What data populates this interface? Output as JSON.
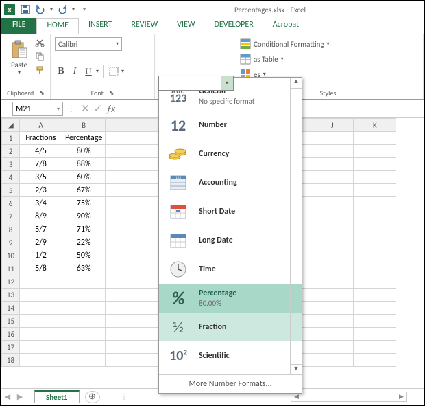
{
  "app": {
    "title": "Percentages.xlsx - Excel"
  },
  "qat": {
    "save": "save",
    "undo": "undo",
    "redo": "redo"
  },
  "tabs": {
    "file": "FILE",
    "home": "HOME",
    "insert": "INSERT",
    "review": "REVIEW",
    "view": "VIEW",
    "developer": "DEVELOPER",
    "acrobat": "Acrobat"
  },
  "ribbon": {
    "clipboard": {
      "paste": "Paste",
      "label": "Clipboard"
    },
    "font": {
      "family": "Calibri",
      "bold": "B",
      "italic": "I",
      "underline": "U",
      "label": "Font"
    },
    "styles": {
      "cond": "Conditional Formatting",
      "table": "as Table",
      "cell": "es",
      "label": "Styles"
    }
  },
  "fbar": {
    "namebox": "M21"
  },
  "grid": {
    "cols": [
      "A",
      "B",
      "J",
      "K"
    ],
    "rows": [
      {
        "n": "1",
        "a": "Fractions",
        "b": "Percentage"
      },
      {
        "n": "2",
        "a": "4/5",
        "b": "80%"
      },
      {
        "n": "3",
        "a": "7/8",
        "b": "88%"
      },
      {
        "n": "4",
        "a": "3/5",
        "b": "60%"
      },
      {
        "n": "5",
        "a": "2/3",
        "b": "67%"
      },
      {
        "n": "6",
        "a": "3/4",
        "b": "75%"
      },
      {
        "n": "7",
        "a": "8/9",
        "b": "90%"
      },
      {
        "n": "8",
        "a": "5/7",
        "b": "71%"
      },
      {
        "n": "9",
        "a": "2/9",
        "b": "22%"
      },
      {
        "n": "10",
        "a": "1/2",
        "b": "50%"
      },
      {
        "n": "11",
        "a": "5/8",
        "b": "63%"
      },
      {
        "n": "12",
        "a": "",
        "b": ""
      },
      {
        "n": "13",
        "a": "",
        "b": ""
      },
      {
        "n": "14",
        "a": "",
        "b": ""
      },
      {
        "n": "15",
        "a": "",
        "b": ""
      },
      {
        "n": "16",
        "a": "",
        "b": ""
      },
      {
        "n": "17",
        "a": "",
        "b": ""
      },
      {
        "n": "18",
        "a": "",
        "b": ""
      }
    ]
  },
  "nf": {
    "general": {
      "name": "General",
      "sub": "No specific format"
    },
    "number": {
      "name": "Number"
    },
    "currency": {
      "name": "Currency"
    },
    "accounting": {
      "name": "Accounting"
    },
    "shortdate": {
      "name": "Short Date"
    },
    "longdate": {
      "name": "Long Date"
    },
    "time": {
      "name": "Time"
    },
    "percentage": {
      "name": "Percentage",
      "sub": "80.00%"
    },
    "fraction": {
      "name": "Fraction"
    },
    "scientific": {
      "name": "Scientific"
    },
    "more": "More Number Formats..."
  },
  "sheet": {
    "name": "Sheet1"
  }
}
